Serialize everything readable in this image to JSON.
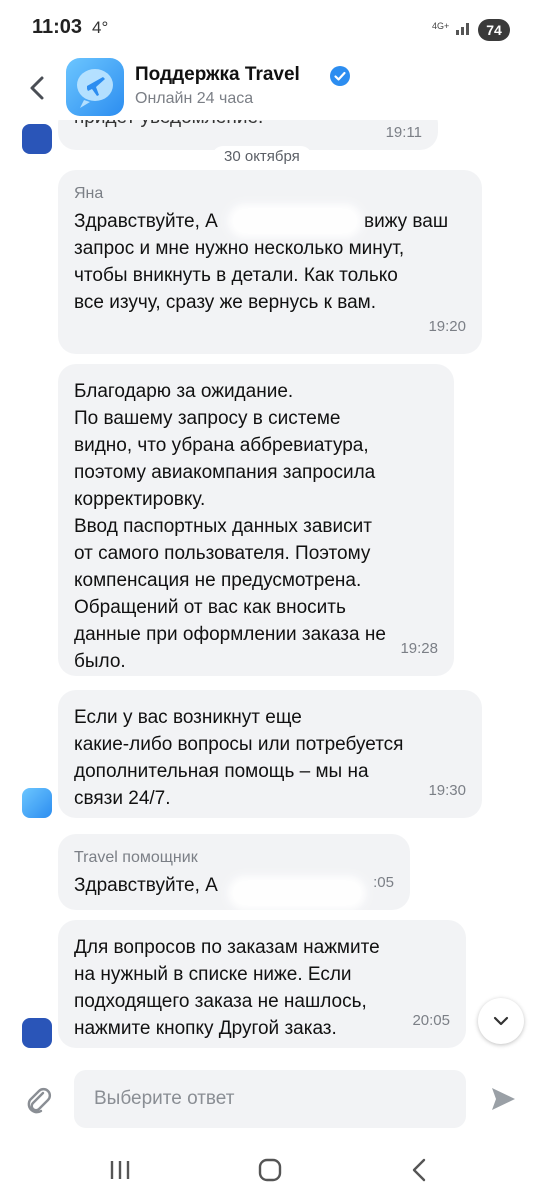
{
  "status_bar": {
    "time": "11:03",
    "extra": "4°",
    "network": "4G+",
    "battery": "74"
  },
  "header": {
    "title": "Поддержка Travel",
    "subtitle": "Онлайн 24 часа"
  },
  "chat": {
    "partial_message": {
      "text": "придет уведомление.",
      "time": "19:11"
    },
    "date_separator": "30 октября",
    "messages": [
      {
        "sender": "Яна",
        "text": "Здравствуйте, А\nзапрос и мне нужно несколько минут,\nчтобы вникнуть в детали. Как только\nвсе изучу, сразу же вернусь к вам.",
        "tail": "вижу ваш",
        "time": "19:20"
      },
      {
        "text": "Благодарю за ожидание.\nПо вашему запросу в системе\nвидно, что убрана аббревиатура,\nпоэтому авиакомпания запросила\nкорректировку.\nВвод паспортных данных зависит\nот самого пользователя. Поэтому\nкомпенсация не предусмотрена.\nОбращений от вас как вносить\nданные при оформлении заказа не\nбыло.",
        "time": "19:28"
      },
      {
        "text": "Если у вас возникнут еще\nкакие-либо вопросы или потребуется\nдополнительная помощь – мы на\nсвязи 24/7.",
        "time": "19:30"
      },
      {
        "sender": "Travel помощник",
        "text": "Здравствуйте, А",
        "time": ":05"
      },
      {
        "text": "Для вопросов по заказам нажмите\nна нужный в списке ниже. Если\nподходящего заказа не нашлось,\nнажмите кнопку Другой заказ.",
        "time": "20:05"
      }
    ]
  },
  "input": {
    "placeholder": "Выберите ответ"
  },
  "icons": {
    "back": "chevron-left-icon",
    "verified": "verified-badge-icon",
    "attach": "paperclip-icon",
    "send": "send-icon",
    "scroll": "chevron-down-icon"
  },
  "colors": {
    "accent": "#2c8df0",
    "bubble": "#f2f3f5",
    "muted": "#7b7f86"
  }
}
